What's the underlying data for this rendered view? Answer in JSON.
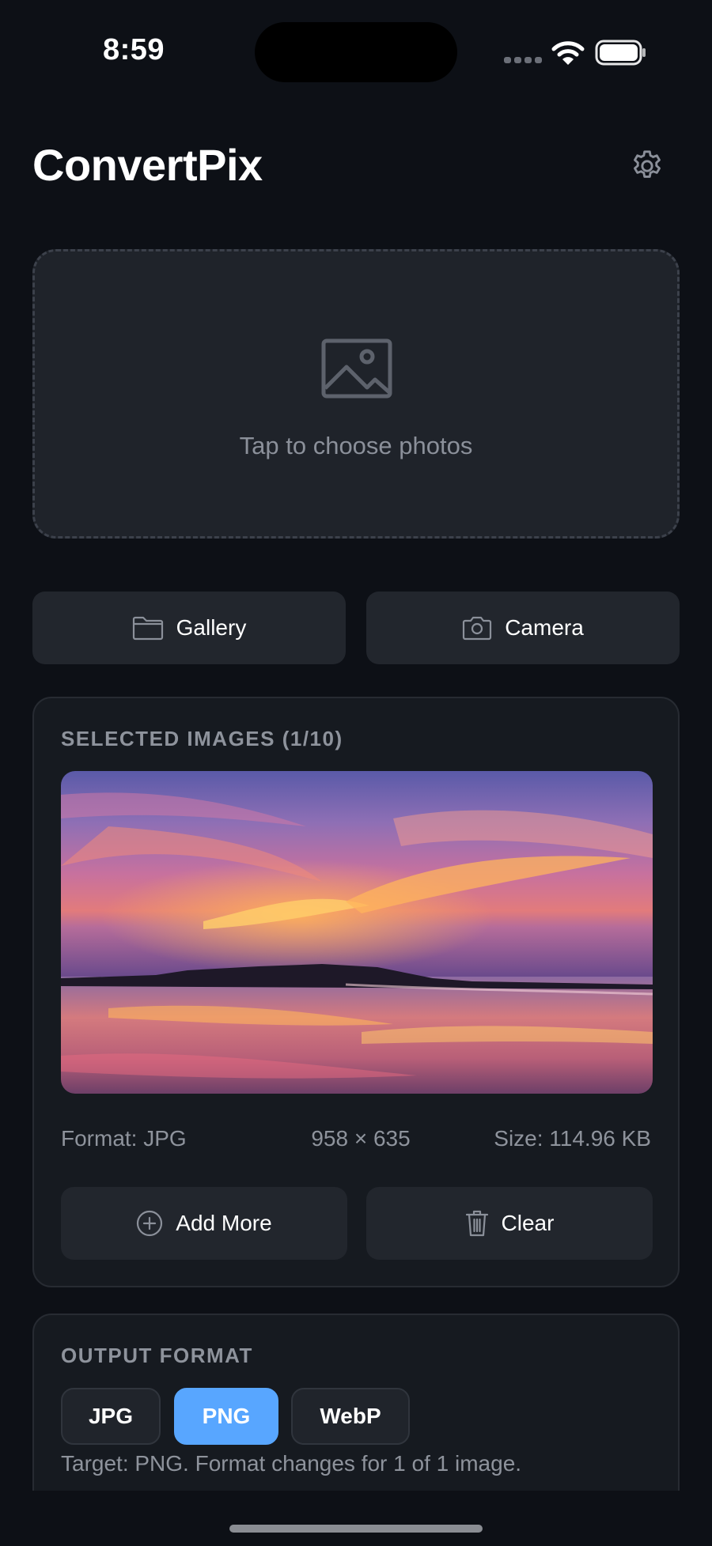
{
  "status_bar": {
    "time": "8:59"
  },
  "header": {
    "title": "ConvertPix",
    "settings_icon": "gear-icon"
  },
  "dropzone": {
    "icon": "photo-icon",
    "text": "Tap to choose photos"
  },
  "source_buttons": {
    "gallery": {
      "label": "Gallery",
      "icon": "folder-icon"
    },
    "camera": {
      "label": "Camera",
      "icon": "camera-icon"
    }
  },
  "selected_images": {
    "title": "SELECTED IMAGES (1/10)",
    "preview_description": "sunset beach photo",
    "format": "Format: JPG",
    "dimensions": "958 × 635",
    "size": "Size: 114.96 KB",
    "add_more_label": "Add More",
    "clear_label": "Clear"
  },
  "output_format": {
    "title": "OUTPUT FORMAT",
    "options": [
      "JPG",
      "PNG",
      "WebP"
    ],
    "selected": "PNG",
    "target_text": "Target: PNG. Format changes for 1 of 1 image."
  },
  "colors": {
    "background": "#0d1016",
    "card": "#161a20",
    "accent": "#58a6ff",
    "muted_text": "#8e939c"
  }
}
